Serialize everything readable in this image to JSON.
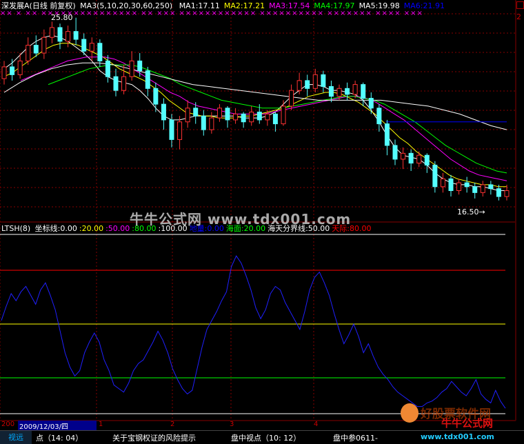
{
  "header": {
    "stock": "深发展A",
    "period": "(日线 前复权)",
    "ma_params": "MA3(5,10,20,30,60,250)",
    "ma": [
      {
        "label": "MA1:17.11",
        "color": "#ffffff"
      },
      {
        "label": "MA2:17.21",
        "color": "#ffff00"
      },
      {
        "label": "MA3:17.54",
        "color": "#ff00ff"
      },
      {
        "label": "MA4:17.97",
        "color": "#00ff00"
      },
      {
        "label": "MA5:19.98",
        "color": "#ffffff"
      },
      {
        "label": "MA6:21.91",
        "color": "#0000ff"
      }
    ]
  },
  "price_panel": {
    "high_label": "25.80",
    "low_label": "16.50→",
    "xx_ribbon": "××  ×  ××  ×××××××××××××××  ××  ×××  ××××××××××××  ××××××××××  ×××××××  ××××  ×××",
    "candles": [
      {
        "o": 22.7,
        "c": 23.3,
        "h": 23.6,
        "l": 22.4
      },
      {
        "o": 23.3,
        "c": 22.9,
        "h": 23.7,
        "l": 22.6
      },
      {
        "o": 22.9,
        "c": 23.6,
        "h": 24.0,
        "l": 22.7
      },
      {
        "o": 23.6,
        "c": 24.4,
        "h": 24.8,
        "l": 23.4
      },
      {
        "o": 24.4,
        "c": 24.0,
        "h": 24.9,
        "l": 23.8
      },
      {
        "o": 24.0,
        "c": 24.8,
        "h": 25.2,
        "l": 23.7
      },
      {
        "o": 24.8,
        "c": 25.3,
        "h": 25.6,
        "l": 24.5
      },
      {
        "o": 25.3,
        "c": 24.6,
        "h": 25.5,
        "l": 24.2
      },
      {
        "o": 24.6,
        "c": 25.1,
        "h": 25.4,
        "l": 24.3
      },
      {
        "o": 25.1,
        "c": 24.7,
        "h": 25.8,
        "l": 24.4
      },
      {
        "o": 24.7,
        "c": 24.1,
        "h": 25.0,
        "l": 23.9
      },
      {
        "o": 24.1,
        "c": 24.5,
        "h": 24.8,
        "l": 23.6
      },
      {
        "o": 24.5,
        "c": 23.6,
        "h": 24.7,
        "l": 23.3
      },
      {
        "o": 23.6,
        "c": 22.8,
        "h": 23.9,
        "l": 22.5
      },
      {
        "o": 22.8,
        "c": 22.1,
        "h": 23.2,
        "l": 21.8
      },
      {
        "o": 22.1,
        "c": 22.8,
        "h": 23.4,
        "l": 21.9
      },
      {
        "o": 22.8,
        "c": 23.6,
        "h": 24.1,
        "l": 22.6
      },
      {
        "o": 23.6,
        "c": 23.1,
        "h": 24.0,
        "l": 22.8
      },
      {
        "o": 23.1,
        "c": 22.2,
        "h": 23.3,
        "l": 21.8
      },
      {
        "o": 22.2,
        "c": 21.4,
        "h": 22.5,
        "l": 21.0
      },
      {
        "o": 21.4,
        "c": 20.6,
        "h": 21.7,
        "l": 20.1
      },
      {
        "o": 20.6,
        "c": 19.6,
        "h": 20.9,
        "l": 19.2
      },
      {
        "o": 19.6,
        "c": 20.5,
        "h": 20.8,
        "l": 19.1
      },
      {
        "o": 20.5,
        "c": 21.2,
        "h": 21.6,
        "l": 20.2
      },
      {
        "o": 21.2,
        "c": 20.8,
        "h": 21.5,
        "l": 20.4
      },
      {
        "o": 20.8,
        "c": 20.1,
        "h": 21.1,
        "l": 19.8
      },
      {
        "o": 20.1,
        "c": 20.7,
        "h": 21.0,
        "l": 19.9
      },
      {
        "o": 20.7,
        "c": 21.2,
        "h": 21.4,
        "l": 20.5
      },
      {
        "o": 21.2,
        "c": 20.6,
        "h": 21.3,
        "l": 20.2
      },
      {
        "o": 20.6,
        "c": 20.9,
        "h": 21.2,
        "l": 20.4
      },
      {
        "o": 20.9,
        "c": 20.5,
        "h": 21.0,
        "l": 20.2
      },
      {
        "o": 20.5,
        "c": 21.0,
        "h": 21.3,
        "l": 20.3
      },
      {
        "o": 21.0,
        "c": 20.6,
        "h": 21.4,
        "l": 20.4
      },
      {
        "o": 20.6,
        "c": 20.9,
        "h": 21.1,
        "l": 20.3
      },
      {
        "o": 20.9,
        "c": 20.4,
        "h": 21.0,
        "l": 20.0
      },
      {
        "o": 20.4,
        "c": 21.3,
        "h": 21.6,
        "l": 20.3
      },
      {
        "o": 21.3,
        "c": 22.1,
        "h": 22.4,
        "l": 21.1
      },
      {
        "o": 22.1,
        "c": 22.6,
        "h": 23.0,
        "l": 21.9
      },
      {
        "o": 22.6,
        "c": 22.2,
        "h": 22.9,
        "l": 21.8
      },
      {
        "o": 22.2,
        "c": 22.9,
        "h": 23.2,
        "l": 22.0
      },
      {
        "o": 22.9,
        "c": 22.3,
        "h": 23.1,
        "l": 22.0
      },
      {
        "o": 22.3,
        "c": 21.8,
        "h": 22.6,
        "l": 21.5
      },
      {
        "o": 21.8,
        "c": 22.2,
        "h": 22.4,
        "l": 21.6
      },
      {
        "o": 22.2,
        "c": 21.9,
        "h": 22.5,
        "l": 21.6
      },
      {
        "o": 21.9,
        "c": 22.4,
        "h": 22.6,
        "l": 21.7
      },
      {
        "o": 22.4,
        "c": 21.7,
        "h": 22.5,
        "l": 21.3
      },
      {
        "o": 21.7,
        "c": 21.2,
        "h": 22.0,
        "l": 20.9
      },
      {
        "o": 21.2,
        "c": 20.4,
        "h": 21.4,
        "l": 20.0
      },
      {
        "o": 20.4,
        "c": 19.3,
        "h": 20.6,
        "l": 18.8
      },
      {
        "o": 19.3,
        "c": 18.6,
        "h": 19.6,
        "l": 18.3
      },
      {
        "o": 18.6,
        "c": 18.9,
        "h": 19.2,
        "l": 18.1
      },
      {
        "o": 18.9,
        "c": 18.4,
        "h": 19.1,
        "l": 18.0
      },
      {
        "o": 18.4,
        "c": 18.8,
        "h": 19.0,
        "l": 18.2
      },
      {
        "o": 18.8,
        "c": 18.3,
        "h": 18.9,
        "l": 17.9
      },
      {
        "o": 18.3,
        "c": 17.2,
        "h": 18.5,
        "l": 16.9
      },
      {
        "o": 17.2,
        "c": 17.6,
        "h": 17.9,
        "l": 16.9
      },
      {
        "o": 17.6,
        "c": 17.0,
        "h": 17.8,
        "l": 16.7
      },
      {
        "o": 17.0,
        "c": 17.4,
        "h": 17.6,
        "l": 16.8
      },
      {
        "o": 17.4,
        "c": 17.2,
        "h": 17.7,
        "l": 16.9
      },
      {
        "o": 17.2,
        "c": 16.9,
        "h": 17.4,
        "l": 16.6
      },
      {
        "o": 16.9,
        "c": 17.3,
        "h": 17.5,
        "l": 16.7
      },
      {
        "o": 17.3,
        "c": 17.1,
        "h": 17.5,
        "l": 16.8
      },
      {
        "o": 17.1,
        "c": 16.7,
        "h": 17.3,
        "l": 16.5
      },
      {
        "o": 16.7,
        "c": 17.0,
        "h": 17.3,
        "l": 16.5
      }
    ],
    "ma_lines": [
      {
        "color": "#ffffff",
        "vals": [
          23.2,
          23.5,
          23.9,
          24.3,
          24.6,
          24.8,
          24.9,
          24.8,
          24.6,
          24.3,
          24.0,
          23.6,
          23.1,
          22.8,
          22.6,
          22.5,
          22.4,
          22.1,
          21.7,
          21.2,
          20.8,
          20.6,
          20.6,
          20.7,
          20.8,
          20.8,
          20.8,
          20.8,
          20.8,
          20.8,
          20.7,
          20.7,
          20.7,
          20.8,
          21.0,
          21.4,
          21.8,
          22.1,
          22.4,
          22.4,
          22.3,
          22.1,
          22.1,
          22.0,
          21.9,
          21.6,
          21.1,
          20.5,
          19.8,
          19.2,
          18.8,
          18.7,
          18.6,
          18.3,
          17.9,
          17.6,
          17.4,
          17.3,
          17.3,
          17.2,
          17.2,
          17.1,
          17.0,
          17.0
        ]
      },
      {
        "color": "#ffff00",
        "vals": [
          22.8,
          23.0,
          23.3,
          23.6,
          23.9,
          24.2,
          24.4,
          24.5,
          24.5,
          24.4,
          24.2,
          24.0,
          23.8,
          23.5,
          23.2,
          23.0,
          22.8,
          22.6,
          22.3,
          22.0,
          21.6,
          21.3,
          21.0,
          20.9,
          20.8,
          20.8,
          20.7,
          20.7,
          20.7,
          20.8,
          20.8,
          20.9,
          21.0,
          21.1,
          21.2,
          21.4,
          21.6,
          21.8,
          21.9,
          22.0,
          22.0,
          21.9,
          21.7,
          21.5,
          21.2,
          20.9,
          20.5,
          20.1,
          19.7,
          19.4,
          19.0,
          18.7,
          18.4,
          18.1,
          17.8,
          17.6,
          17.5,
          17.4,
          17.3,
          17.3,
          17.2,
          17.2
        ]
      },
      {
        "color": "#ff00ff",
        "vals": [
          22.6,
          22.8,
          23.0,
          23.2,
          23.4,
          23.6,
          23.7,
          23.8,
          23.8,
          23.8,
          23.7,
          23.5,
          23.2,
          22.9,
          22.6,
          22.3,
          22.0,
          21.8,
          21.5,
          21.3,
          21.2,
          21.1,
          21.0,
          20.9,
          20.9,
          20.9,
          20.9,
          21.0,
          21.1,
          21.2,
          21.3,
          21.4,
          21.5,
          21.6,
          21.7,
          21.8,
          21.8,
          21.7,
          21.5,
          21.2,
          20.9,
          20.6,
          20.2,
          19.8,
          19.4,
          19.0,
          18.6,
          18.3,
          18.0,
          17.8,
          17.7,
          17.6,
          17.5
        ]
      },
      {
        "color": "#00ff00",
        "vals": [
          22.4,
          22.6,
          22.8,
          23.0,
          23.2,
          23.3,
          23.4,
          23.4,
          23.4,
          23.3,
          23.1,
          22.9,
          22.7,
          22.4,
          22.2,
          22.0,
          21.8,
          21.6,
          21.5,
          21.4,
          21.3,
          21.2,
          21.2,
          21.2,
          21.3,
          21.4,
          21.5,
          21.6,
          21.7,
          21.8,
          21.8,
          21.7,
          21.6,
          21.4,
          21.1,
          20.8,
          20.5,
          20.1,
          19.7,
          19.3,
          19.0,
          18.7,
          18.4,
          18.2,
          18.0,
          17.9
        ]
      },
      {
        "color": "#ffffff",
        "vals": [
          22.0,
          22.5,
          22.9,
          23.2,
          23.4,
          23.5,
          23.5,
          23.4,
          23.2,
          23.0,
          22.8,
          22.6,
          22.4,
          22.3,
          22.2,
          22.1,
          22.0,
          21.9,
          21.8,
          21.7,
          21.6,
          21.6,
          21.6,
          21.6,
          21.6,
          21.5,
          21.4,
          21.3,
          21.1,
          20.9,
          20.6,
          20.3,
          20.1
        ]
      },
      {
        "color": "#0000ff",
        "vals": [
          20.5,
          20.5,
          20.5,
          20.5,
          20.5,
          20.5
        ]
      }
    ]
  },
  "indicator_panel": {
    "name": "LTSH(8)",
    "legend": [
      {
        "label": "坐标线:0.00",
        "color": "#ffffff"
      },
      {
        "label": ":20.00",
        "color": "#ffff00"
      },
      {
        "label": ":50.00",
        "color": "#ff00ff"
      },
      {
        "label": ":80.00",
        "color": "#00ff00"
      },
      {
        "label": ":100.00",
        "color": "#ffffff"
      },
      {
        "label": "地量:0.00",
        "color": "#0000ff"
      },
      {
        "label": "海面:20.00",
        "color": "#00ff00"
      },
      {
        "label": "海天分界线:50.00",
        "color": "#ffffff"
      },
      {
        "label": "天际:80.00",
        "color": "#ff0000"
      }
    ],
    "levels": [
      {
        "v": 100,
        "color": "#ffffff"
      },
      {
        "v": 80,
        "color": "#ff0000"
      },
      {
        "v": 50,
        "color": "#ffff00"
      },
      {
        "v": 20,
        "color": "#00ff00"
      },
      {
        "v": 0,
        "color": "#ffffff"
      }
    ],
    "values": [
      52,
      60,
      67,
      63,
      68,
      71,
      66,
      61,
      69,
      73,
      66,
      58,
      46,
      34,
      26,
      21,
      24,
      34,
      40,
      45,
      40,
      30,
      24,
      16,
      14,
      12,
      17,
      24,
      28,
      30,
      35,
      40,
      46,
      41,
      34,
      25,
      19,
      14,
      11,
      13,
      25,
      37,
      47,
      52,
      57,
      63,
      68,
      82,
      88,
      84,
      77,
      69,
      59,
      53,
      58,
      67,
      71,
      69,
      62,
      57,
      52,
      47,
      57,
      69,
      76,
      79,
      73,
      66,
      56,
      47,
      39,
      44,
      50,
      43,
      34,
      39,
      32,
      26,
      22,
      19,
      15,
      12,
      10,
      8,
      6,
      4,
      4,
      6,
      7,
      9,
      12,
      14,
      18,
      15,
      12,
      10,
      14,
      19,
      11,
      8,
      6,
      13,
      7,
      3
    ]
  },
  "date_bar": {
    "year_prefix": "200",
    "cursor_date": "2009/12/03/四",
    "months": [
      "1",
      "2",
      "3",
      "4"
    ]
  },
  "bottom_bar": {
    "left_tab": "视远",
    "items": [
      "点（14: 04）",
      "关于宝钢权证的风险提示",
      "盘中视点（10: 12）",
      "盘中参0611-"
    ]
  },
  "watermarks": {
    "center": "牛牛公式网 www.tdx001.com",
    "corner_top": "牛牛公式网",
    "corner_bottom": "www.tdx001.com",
    "corner_red": "好股票软件网"
  },
  "right_axis": {
    "right_label": "2"
  }
}
